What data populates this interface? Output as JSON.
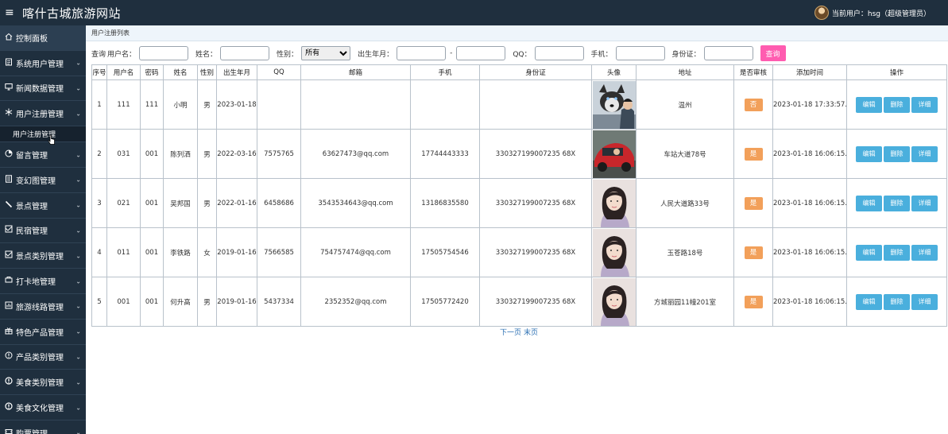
{
  "header": {
    "menu_icon": "hamburger-icon",
    "site_title": "喀什古城旅游网站",
    "current_user_label": "当前用户：hsg（超级管理员）"
  },
  "sidebar": {
    "dashboard": "控制面板",
    "items": [
      {
        "label": "系统用户管理",
        "icon": "list-icon"
      },
      {
        "label": "新闻数据管理",
        "icon": "monitor-icon"
      },
      {
        "label": "用户注册管理",
        "icon": "snowflake-icon"
      },
      {
        "label": "留言管理",
        "icon": "pie-icon"
      },
      {
        "label": "变幻图管理",
        "icon": "document-icon"
      },
      {
        "label": "景点管理",
        "icon": "brush-icon"
      },
      {
        "label": "民宿管理",
        "icon": "picture-icon"
      },
      {
        "label": "景点类别管理",
        "icon": "picture-icon"
      },
      {
        "label": "打卡地管理",
        "icon": "stamp-icon"
      },
      {
        "label": "旅游线路管理",
        "icon": "chart-icon"
      },
      {
        "label": "特色产品管理",
        "icon": "gift-icon"
      },
      {
        "label": "产品类别管理",
        "icon": "info-icon"
      },
      {
        "label": "美食类别管理",
        "icon": "alert-icon"
      },
      {
        "label": "美食文化管理",
        "icon": "alert-icon"
      },
      {
        "label": "购票管理",
        "icon": "ticket-icon"
      }
    ],
    "active_sub": "用户注册管理"
  },
  "breadcrumb": "用户注册列表",
  "search": {
    "prefix": "查询",
    "username_label": "用户名：",
    "name_label": "姓名：",
    "gender_label": "性别：",
    "gender_selected": "所有",
    "birth_label": "出生年月：",
    "range_sep": "-",
    "qq_label": "QQ：",
    "phone_label": "手机：",
    "idcard_label": "身份证：",
    "submit_label": "查询"
  },
  "table": {
    "headers": [
      "序号",
      "用户名",
      "密码",
      "姓名",
      "性别",
      "出生年月",
      "QQ",
      "邮箱",
      "手机",
      "身份证",
      "头像",
      "地址",
      "是否审核",
      "添加时间",
      "操作"
    ],
    "rows": [
      {
        "no": "1",
        "username": "111",
        "password": "111",
        "name": "小明",
        "gender": "男",
        "birth": "2023-01-18",
        "qq": "",
        "email": "",
        "phone": "",
        "idcard": "",
        "avatar": "husky-photo",
        "address": "温州",
        "audit": "否",
        "added": "2023-01-18 17:33:57.0"
      },
      {
        "no": "2",
        "username": "031",
        "password": "001",
        "name": "陈列洒",
        "gender": "男",
        "birth": "2022-03-16",
        "qq": "7575765",
        "email": "63627473@qq.com",
        "phone": "17744443333",
        "idcard": "330327199007235 68X",
        "avatar": "car-photo",
        "address": "车站大道78号",
        "audit": "是",
        "added": "2023-01-18 16:06:15.0"
      },
      {
        "no": "3",
        "username": "021",
        "password": "001",
        "name": "吴邦国",
        "gender": "男",
        "birth": "2022-01-16",
        "qq": "6458686",
        "email": "3543534643@qq.com",
        "phone": "13186835580",
        "idcard": "330327199007235 68X",
        "avatar": "girl-photo",
        "address": "人民大道路33号",
        "audit": "是",
        "added": "2023-01-18 16:06:15.0"
      },
      {
        "no": "4",
        "username": "011",
        "password": "001",
        "name": "李铁路",
        "gender": "女",
        "birth": "2019-01-16",
        "qq": "7566585",
        "email": "754757474@qq.com",
        "phone": "17505754546",
        "idcard": "330327199007235 68X",
        "avatar": "girl-photo",
        "address": "玉苍路18号",
        "audit": "是",
        "added": "2023-01-18 16:06:15.0"
      },
      {
        "no": "5",
        "username": "001",
        "password": "001",
        "name": "何升高",
        "gender": "男",
        "birth": "2019-01-16",
        "qq": "5437334",
        "email": "2352352@qq.com",
        "phone": "17505772420",
        "idcard": "330327199007235 68X",
        "avatar": "girl-photo",
        "address": "方城丽园11幢201室",
        "audit": "是",
        "added": "2023-01-18 16:06:15.0"
      }
    ],
    "actions": {
      "edit": "编辑",
      "delete": "删除",
      "detail": "详细"
    }
  },
  "pager": {
    "next": "下一页",
    "last": "末页"
  },
  "colors": {
    "sidebar_bg": "#1f2f3e",
    "query_button": "#ff5cb0",
    "action_button": "#4aafdd",
    "audit_badge": "#f2a05a"
  }
}
